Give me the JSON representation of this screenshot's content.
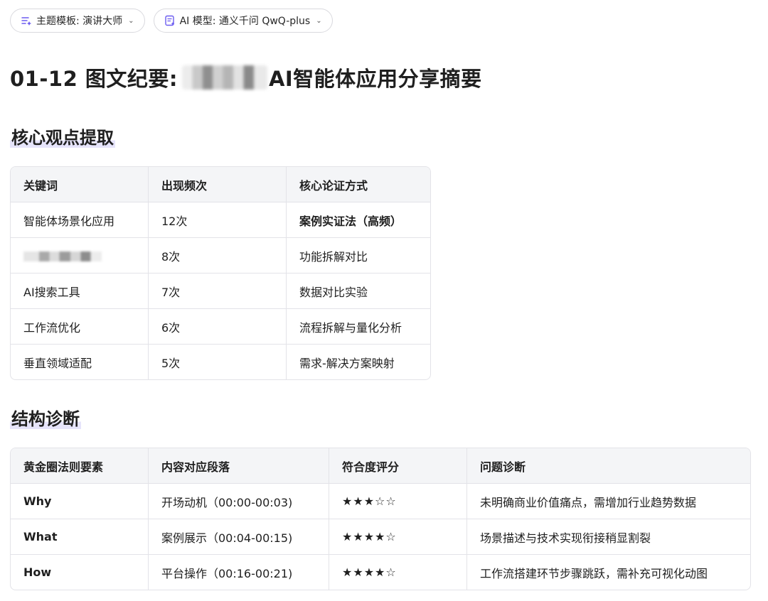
{
  "toolbar": {
    "theme_label": "主题模板: 演讲大师",
    "model_label": "AI 模型: 通义千问 QwQ-plus"
  },
  "title": {
    "prefix": "01-12 图文纪要:",
    "suffix": "AI智能体应用分享摘要"
  },
  "sections": {
    "core": "核心观点提取",
    "structure": "结构诊断"
  },
  "core_table": {
    "headers": [
      "关键词",
      "出现频次",
      "核心论证方式"
    ],
    "rows": [
      [
        "智能体场景化应用",
        "12次",
        "案例实证法（高频）"
      ],
      [
        "",
        "8次",
        "功能拆解对比"
      ],
      [
        "AI搜索工具",
        "7次",
        "数据对比实验"
      ],
      [
        "工作流优化",
        "6次",
        "流程拆解与量化分析"
      ],
      [
        "垂直领域适配",
        "5次",
        "需求-解决方案映射"
      ]
    ]
  },
  "structure_table": {
    "headers": [
      "黄金圈法则要素",
      "内容对应段落",
      "符合度评分",
      "问题诊断"
    ],
    "rows": [
      [
        "Why",
        "开场动机（00:00-00:03)",
        "★★★☆☆",
        "未明确商业价值痛点，需增加行业趋势数据"
      ],
      [
        "What",
        "案例展示（00:04-00:15)",
        "★★★★☆",
        "场景描述与技术实现衔接稍显割裂"
      ],
      [
        "How",
        "平台操作（00:16-00:21)",
        "★★★★☆",
        "工作流搭建环节步骤跳跃，需补充可视化动图"
      ]
    ]
  },
  "icons": {
    "theme": "theme-template-icon",
    "model": "ai-model-icon",
    "chevron": "chevron-down-icon"
  },
  "colors": {
    "accent_icon": "#6b5cf0",
    "heading_highlight": "#e6e4fb",
    "table_header_bg": "#f4f5f7"
  }
}
